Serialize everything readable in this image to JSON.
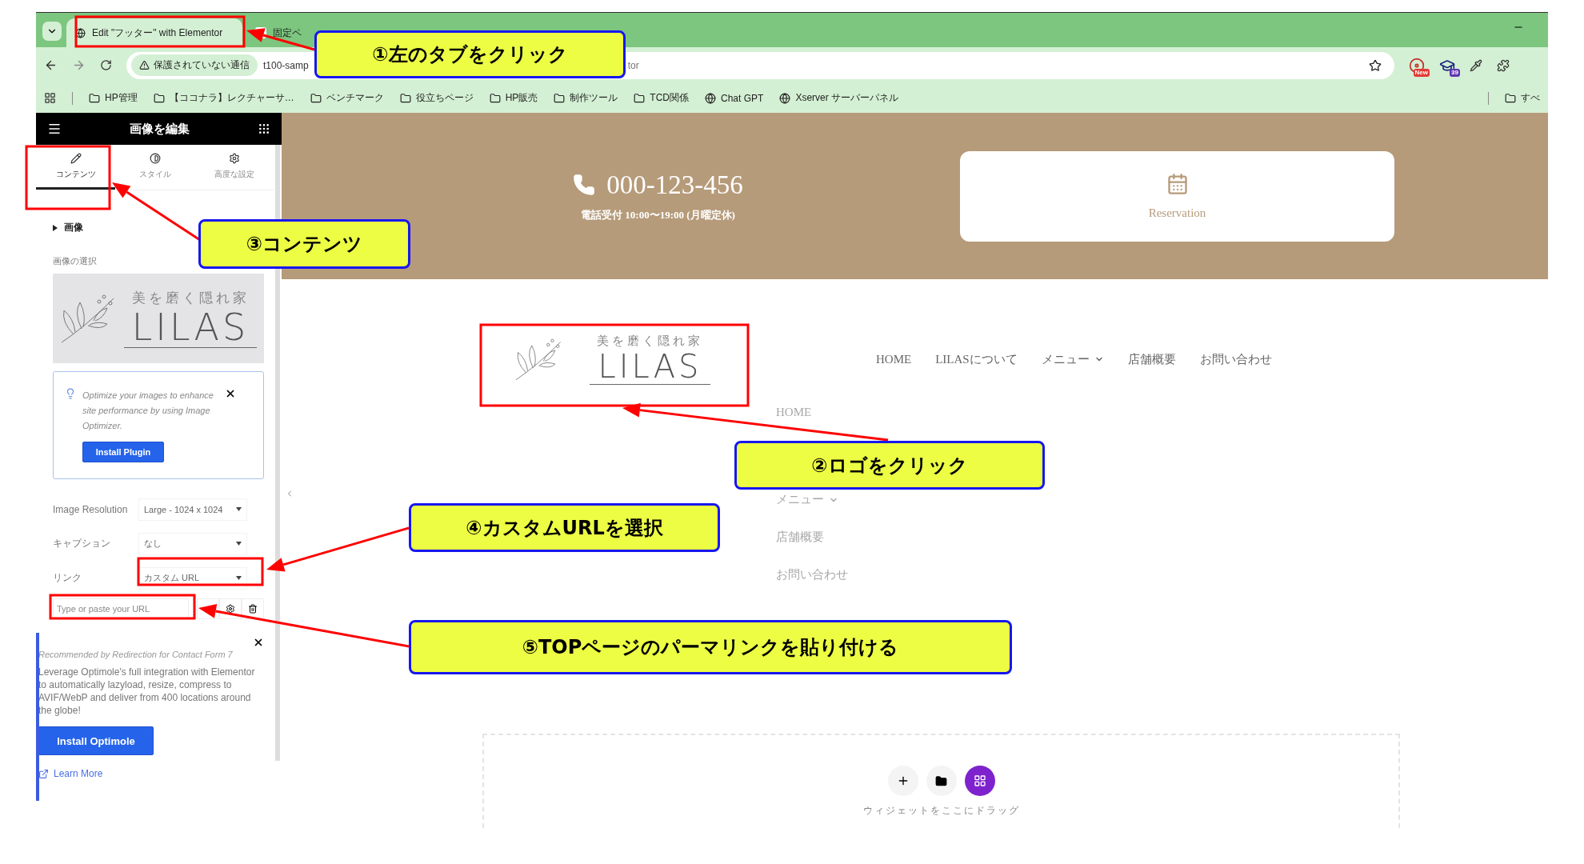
{
  "browser": {
    "tabs": [
      {
        "title": "Edit \"フッター\" with Elementor",
        "selected": true
      },
      {
        "title": "固定ペ",
        "selected": false
      }
    ],
    "address_bar": {
      "security_label": "保護されていない通信",
      "url_start": "t100-samp",
      "url_end": "tor"
    },
    "extension_badges": [
      "New",
      "39"
    ],
    "bookmarks": [
      {
        "label": "HP管理",
        "kind": "folder"
      },
      {
        "label": "【ココナラ】レクチャーサ…",
        "kind": "folder"
      },
      {
        "label": "ベンチマーク",
        "kind": "folder"
      },
      {
        "label": "役立ちページ",
        "kind": "folder"
      },
      {
        "label": "HP販売",
        "kind": "folder"
      },
      {
        "label": "制作ツール",
        "kind": "folder"
      },
      {
        "label": "TCD関係",
        "kind": "folder"
      },
      {
        "label": "Chat GPT",
        "kind": "site"
      },
      {
        "label": "Xserver サーバーパネル",
        "kind": "site"
      }
    ],
    "bookmarks_end": "すべ"
  },
  "editor_panel": {
    "title": "画像を編集",
    "tabs": [
      {
        "label": "コンテンツ",
        "selected": true
      },
      {
        "label": "スタイル",
        "selected": false
      },
      {
        "label": "高度な設定",
        "selected": false
      }
    ],
    "section_title": "画像",
    "image_label": "画像の選択",
    "preview": {
      "tagline": "美を磨く隠れ家",
      "name": "LILAS"
    },
    "notice": {
      "text": "Optimize your images to enhance site performance by using Image Optimizer.",
      "button": "Install Plugin"
    },
    "fields": [
      {
        "label": "Image Resolution",
        "value": "Large - 1024 x 1024"
      },
      {
        "label": "キャプション",
        "value": "なし"
      },
      {
        "label": "リンク",
        "value": "カスタム URL"
      }
    ],
    "url_field": {
      "placeholder": "Type or paste your URL"
    },
    "promo": {
      "source": "Recommended by Redirection for Contact Form 7",
      "text": "Leverage Optimole's full integration with Elementor to automatically lazyload, resize, compress to AVIF/WebP and deliver from 400 locations around the globe!",
      "button": "Install Optimole",
      "link": "Learn More"
    }
  },
  "site": {
    "phone": "000-123-456",
    "hours": "電話受付 10:00〜19:00 (月曜定休)",
    "reservation": "Reservation",
    "logo": {
      "tagline": "美を磨く隠れ家",
      "name": "LILAS"
    },
    "nav": [
      {
        "label": "HOME",
        "has_submenu": false
      },
      {
        "label": "LILASについて",
        "has_submenu": false
      },
      {
        "label": "メニュー",
        "has_submenu": true
      },
      {
        "label": "店舗概要",
        "has_submenu": false
      },
      {
        "label": "お問い合わせ",
        "has_submenu": false
      }
    ],
    "faded_menu": [
      {
        "label": "HOME",
        "has_submenu": false
      },
      {
        "label": "メニュー",
        "has_submenu": true
      },
      {
        "label": "店舗概要",
        "has_submenu": false
      },
      {
        "label": "お問い合わせ",
        "has_submenu": false
      }
    ],
    "drop_zone": {
      "hint": "ウィジェットをここにドラッグ"
    }
  },
  "annotations": [
    "①左のタブをクリック",
    "②ロゴをクリック",
    "③コンテンツ",
    "④カスタムURLを選択",
    "⑤TOPページのパーマリンクを貼り付ける"
  ]
}
